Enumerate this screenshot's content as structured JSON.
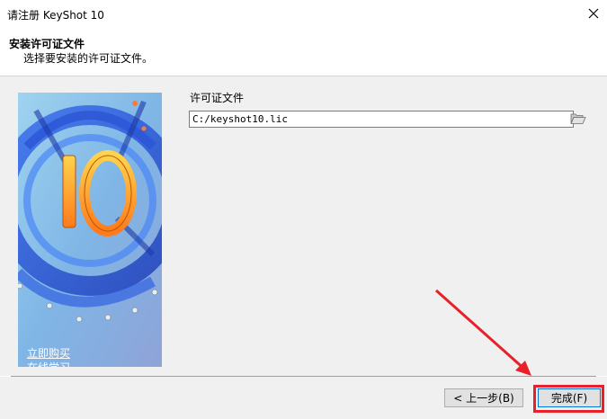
{
  "window": {
    "title": "请注册 KeyShot 10",
    "close_icon": "close-icon"
  },
  "header": {
    "title": "安装许可证文件",
    "subtitle": "选择要安装的许可证文件。"
  },
  "side_image": {
    "big_number": "10",
    "links": [
      "立即购买",
      "在线学习"
    ]
  },
  "license": {
    "label": "许可证文件",
    "path_value": "C:/keyshot10.lic",
    "browse_icon": "folder-open-icon"
  },
  "buttons": {
    "back_label": "< 上一步(B)",
    "finish_label": "完成(F)"
  },
  "colors": {
    "highlight": "#e8202a",
    "arrow": "#e8202a",
    "finish_border": "#0078d7"
  }
}
